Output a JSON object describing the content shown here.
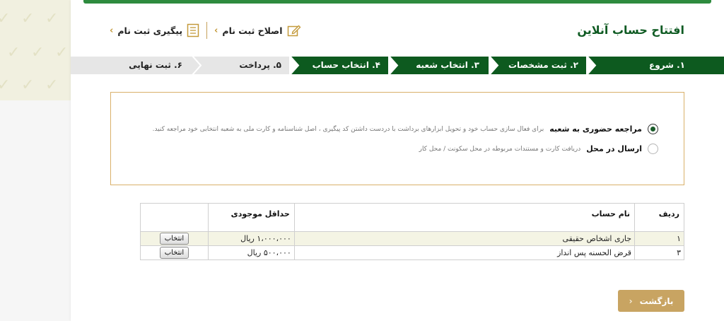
{
  "header": {
    "title": "افتتاح حساب آنلاین",
    "links": [
      {
        "label": "اصلاح ثبت نام",
        "icon": "edit-icon"
      },
      {
        "label": "پیگیری ثبت نام",
        "icon": "document-icon"
      }
    ],
    "chevron": "‹"
  },
  "steps": [
    {
      "label": "۱. شروع",
      "active": true
    },
    {
      "label": "۲. ثبت مشخصات",
      "active": true
    },
    {
      "label": "۳. انتخاب شعبه",
      "active": true
    },
    {
      "label": "۴. انتخاب حساب",
      "active": true
    },
    {
      "label": "۵. پرداخت",
      "active": false
    },
    {
      "label": "۶. ثبت نهایی",
      "active": false
    }
  ],
  "delivery_options": [
    {
      "title": "مراجعه حضوری به شعبه",
      "desc": "برای فعال سازی حساب خود و تحویل ابزارهای برداشت با دردست داشتن کد پیگیری ، اصل شناسنامه و کارت ملی به شعبه انتخابی خود مراجعه کنید.",
      "checked": true
    },
    {
      "title": "ارسال در محل",
      "desc": "دریافت کارت و مستندات مربوطه در محل سکونت / محل کار",
      "checked": false
    }
  ],
  "table": {
    "headers": {
      "index": "ردیف",
      "name": "نام حساب",
      "min_balance": "حداقل موجودی",
      "action": ""
    },
    "rows": [
      {
        "index": "۱",
        "name": "جاری اشخاص حقیقی",
        "min_balance": "۱،۰۰۰،۰۰۰ ریال",
        "action": "انتخاب"
      },
      {
        "index": "۳",
        "name": "قرض الحسنه پس انداز",
        "min_balance": "۵۰۰،۰۰۰ ریال",
        "action": "انتخاب"
      }
    ]
  },
  "back_button": {
    "label": "بازگشت",
    "chevron": "‹"
  },
  "colors": {
    "brand_green": "#0f5b23",
    "step_active": "#0d5a1f",
    "step_inactive": "#e6e6e6",
    "accent_gold": "#c8a462",
    "top_bar": "#2e8b3e"
  }
}
